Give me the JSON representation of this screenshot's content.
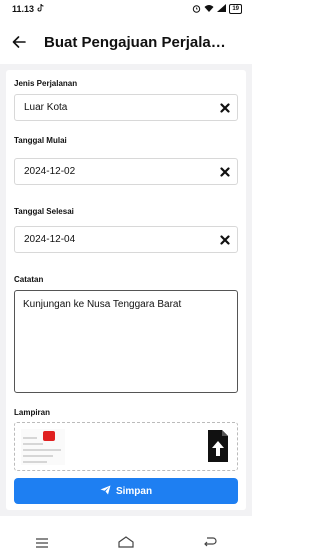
{
  "status_bar": {
    "time": "11.13",
    "battery": "19"
  },
  "app_bar": {
    "title": "Buat Pengajuan Perjalana..."
  },
  "form": {
    "jenis_label": "Jenis Perjalanan",
    "jenis_value": "Luar Kota",
    "mulai_label": "Tanggal Mulai",
    "mulai_value": "2024-12-02",
    "selesai_label": "Tanggal Selesai",
    "selesai_value": "2024-12-04",
    "catatan_label": "Catatan",
    "catatan_value": "Kunjungan ke Nusa Tenggara Barat",
    "lampiran_label": "Lampiran",
    "submit_label": "Simpan"
  },
  "colors": {
    "accent": "#1e7ff2",
    "background": "#f2f2f4"
  }
}
